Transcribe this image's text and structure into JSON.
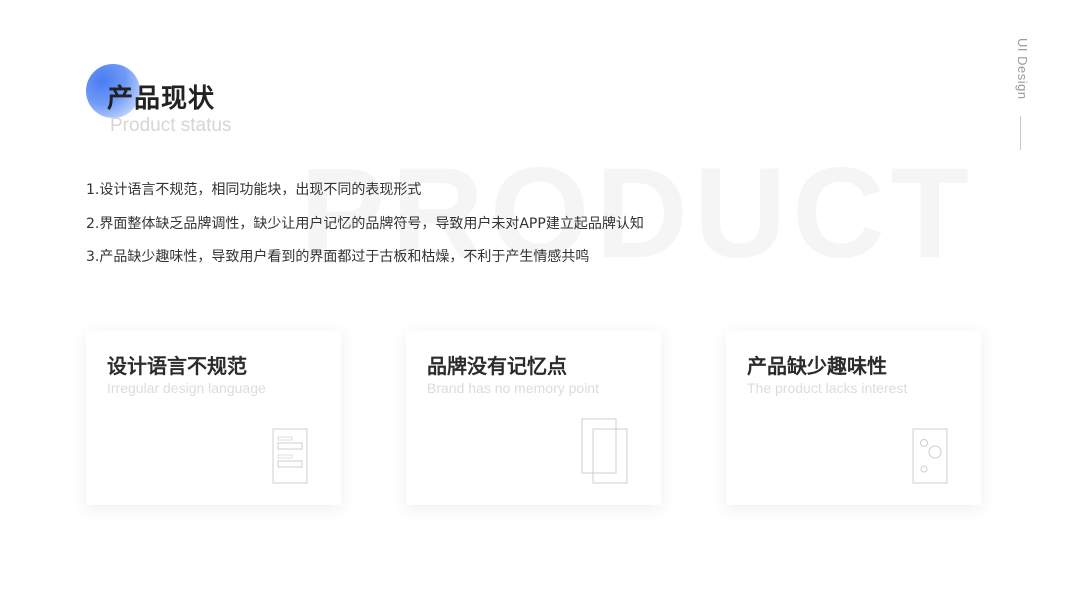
{
  "background_word": "PRODUCT",
  "side": {
    "label": "UI Design"
  },
  "header": {
    "title_cn": "产品现状",
    "title_en": "Product status",
    "accent_color": "#4a7cf3"
  },
  "points": [
    "1.设计语言不规范，相同功能块，出现不同的表现形式",
    "2.界面整体缺乏品牌调性，缺少让用户记忆的品牌符号，导致用户未对APP建立起品牌认知",
    "3.产品缺少趣味性，导致用户看到的界面都过于古板和枯燥，不利于产生情感共鸣"
  ],
  "cards": [
    {
      "title": "设计语言不规范",
      "subtitle": "Irregular design language",
      "icon": "form-layout-icon"
    },
    {
      "title": "品牌没有记忆点",
      "subtitle": "Brand has no memory point",
      "icon": "stacked-pages-icon"
    },
    {
      "title": "产品缺少趣味性",
      "subtitle": "The product lacks interest",
      "icon": "circles-card-icon"
    }
  ]
}
